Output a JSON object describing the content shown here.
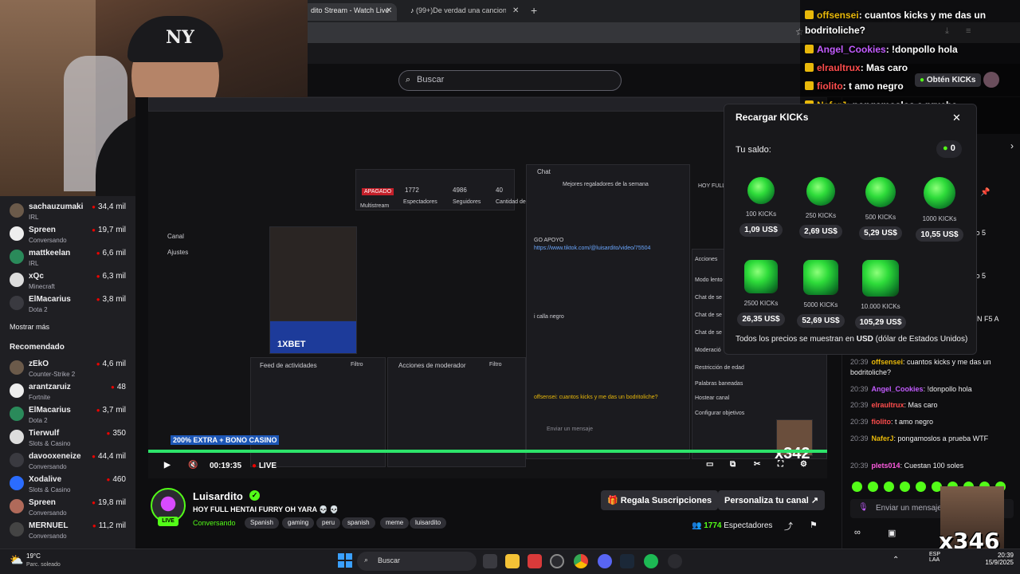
{
  "browser": {
    "tabs": [
      {
        "label": "dito Stream - Watch Live",
        "active": true
      },
      {
        "label": "(99+)De verdad una cancion m",
        "active": false
      }
    ],
    "new_tab": "+"
  },
  "search": {
    "placeholder": "Buscar"
  },
  "webcam": {
    "cap_mark": "NY"
  },
  "sidebar": {
    "following": [
      {
        "name": "sachauzumaki",
        "category": "IRL",
        "viewers": "34,4 mil"
      },
      {
        "name": "Spreen",
        "category": "Conversando",
        "viewers": "19,7 mil"
      },
      {
        "name": "mattkeelan",
        "category": "IRL",
        "viewers": "6,6 mil"
      },
      {
        "name": "xQc",
        "category": "Minecraft",
        "viewers": "6,3 mil"
      },
      {
        "name": "ElMacarius",
        "category": "Dota 2",
        "viewers": "3,8 mil"
      }
    ],
    "show_more": "Mostrar más",
    "recommended_title": "Recomendado",
    "recommended": [
      {
        "name": "zEkO",
        "category": "Counter-Strike 2",
        "viewers": "4,6 mil"
      },
      {
        "name": "arantzaruiz",
        "category": "Fortnite",
        "viewers": "48"
      },
      {
        "name": "ElMacarius",
        "category": "Dota 2",
        "viewers": "3,7 mil"
      },
      {
        "name": "Tierwulf",
        "category": "Slots & Casino",
        "viewers": "350"
      },
      {
        "name": "davooxeneize",
        "category": "Conversando",
        "viewers": "44,4 mil"
      },
      {
        "name": "Xodalive",
        "category": "Slots & Casino",
        "viewers": "460"
      },
      {
        "name": "Spreen",
        "category": "Conversando",
        "viewers": "19,8 mil"
      },
      {
        "name": "MERNUEL",
        "category": "Conversando",
        "viewers": "11,2 mil"
      }
    ]
  },
  "video": {
    "time": "00:19:35",
    "live_label": "LIVE",
    "inner": {
      "chat_label": "Chat",
      "top_donors": "Mejores regaladores de la semana",
      "apagado": "APAGADO",
      "multistream": "Multistream",
      "stats": [
        {
          "value": "1772",
          "label": "Espectadores"
        },
        {
          "value": "4986",
          "label": "Seguidores"
        },
        {
          "value": "40",
          "label": "Cantidad de"
        }
      ],
      "menu": [
        "Canal",
        "Ajustes"
      ],
      "activity": "Feed de actividades",
      "mod_actions": "Acciones de moderador",
      "filter": "Filtro",
      "bet": "1XBET",
      "promo": "200% EXTRA + BONO CASINO",
      "right_menu": [
        "Acciones",
        "Modo lento",
        "Chat de se",
        "Chat de se",
        "Chat de se",
        "Moderació",
        "Restricción de edad",
        "Palabras baneadas",
        "Hostear canal",
        "Configurar objetivos"
      ],
      "enter_msg": "Enviar un mensaje",
      "link": "https://www.tiktok.com/@luisardito/video/75504",
      "chatlines": [
        "GO APOYO",
        "HOY FULL",
        "i calla negro",
        "offsensei: cuantos kicks y me das un bodritoliche?"
      ],
      "x_overlay": "x342"
    }
  },
  "stream": {
    "name": "Luisardito",
    "title": "HOY FULL HENTAI FURRY OH YARA 💀 💀",
    "category": "Conversando",
    "tags": [
      "Spanish",
      "gaming",
      "peru",
      "spanish",
      "meme",
      "luisardito"
    ],
    "live_badge": "LIVE",
    "subs_button": "Regala Suscripciones",
    "customize_button": "Personaliza tu canal",
    "viewers_count": "1774",
    "viewers_label": "Espectadores"
  },
  "overlay_chat": [
    {
      "user": "offsensei",
      "color": "#e8b80a",
      "text": ": cuantos kicks y me das un"
    },
    {
      "user": "",
      "color": "#ffffff",
      "text": "bodritoliche?"
    },
    {
      "user": "Angel_Cookies",
      "color": "#c35cff",
      "text": ": !donpollo hola"
    },
    {
      "user": "elraultrux",
      "color": "#ff4d4d",
      "text": ": Mas caro"
    },
    {
      "user": "fiolito",
      "color": "#ff4d4d",
      "text": ": t amo negro"
    },
    {
      "user": "NaferJ",
      "color": "#e8b80a",
      "text": ": pongamoslos a prueba"
    },
    {
      "user": "plets014",
      "color": "#ff5ce1",
      "text": ": Cuestan 100 soles"
    }
  ],
  "obtain_button": "Obtén KICKs",
  "kicks_popup": {
    "title": "Recargar KICKs",
    "balance_label": "Tu saldo:",
    "balance": "0",
    "packs": [
      {
        "amount": "100 KICKs",
        "price": "1,09 US$"
      },
      {
        "amount": "250 KICKs",
        "price": "2,69 US$"
      },
      {
        "amount": "500 KICKs",
        "price": "5,29 US$"
      },
      {
        "amount": "1000 KICKs",
        "price": "10,55 US$"
      },
      {
        "amount": "2500 KICKs",
        "price": "26,35 US$"
      },
      {
        "amount": "5000 KICKs",
        "price": "52,69 US$"
      },
      {
        "amount": "10.000 KICKs",
        "price": "105,29 US$"
      }
    ],
    "note_prefix": "Todos los precios se muestran en",
    "note_currency": "USD",
    "note_suffix": "(dólar de Estados Unidos)"
  },
  "chat": {
    "partial_lines": [
      "quito 5",
      "quito 5",
      "N F5 A"
    ],
    "messages": [
      {
        "time": "20:39",
        "user": "offsensei",
        "color": "#e8b80a",
        "text": ": cuantos kicks y me das un bodritoliche?"
      },
      {
        "time": "20:39",
        "user": "Angel_Cookies",
        "color": "#c35cff",
        "text": ": !donpollo hola"
      },
      {
        "time": "20:39",
        "user": "elraultrux",
        "color": "#ff4d4d",
        "text": ": Mas caro"
      },
      {
        "time": "20:39",
        "user": "fiolito",
        "color": "#ff4d4d",
        "text": ": t amo negro"
      },
      {
        "time": "20:39",
        "user": "NaferJ",
        "color": "#e8b80a",
        "text": ": pongamoslos a prueba WTF"
      },
      {
        "time": "20:39",
        "user": "plets014",
        "color": "#ff5ce1",
        "text": ": Cuestan 100 soles"
      }
    ],
    "input_placeholder": "Enviar un mensaje",
    "cam_overlay": "x346"
  },
  "taskbar": {
    "weather_temp": "19°C",
    "weather_desc": "Parc. soleado",
    "search": "Buscar",
    "lang1": "ESP",
    "lang2": "LAA",
    "time": "20:39",
    "date": "15/9/2025"
  }
}
